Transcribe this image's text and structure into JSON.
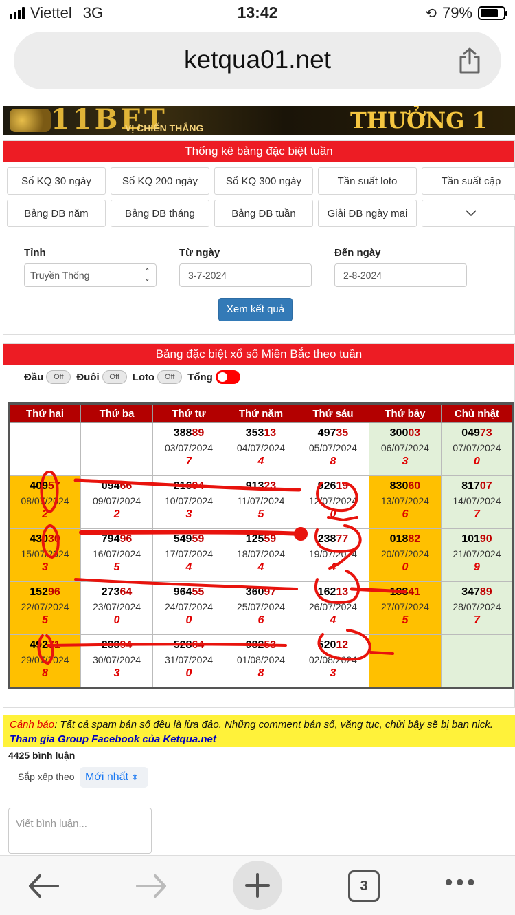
{
  "status": {
    "carrier": "Viettel",
    "network": "3G",
    "time": "13:42",
    "battery": "79%",
    "battery_level": 0.79
  },
  "browser": {
    "url": "ketqua01.net"
  },
  "banner": {
    "logo": "11BET",
    "tagline": "VỊ CHIẾN THẮNG",
    "promo": "THƯỞNG 1"
  },
  "panel1": {
    "title": "Thống kê bảng đặc biệt tuần",
    "buttons_row1": [
      "Sổ KQ 30 ngày",
      "Sổ KQ 200 ngày",
      "Sổ KQ 300 ngày",
      "Tần suất loto",
      "Tần suất cặp"
    ],
    "buttons_row2": [
      "Bảng ĐB năm",
      "Bảng ĐB tháng",
      "Bảng ĐB tuần",
      "Giải ĐB ngày mai"
    ],
    "province_label": "Tỉnh",
    "province_value": "Truyền Thống",
    "from_label": "Từ ngày",
    "from_value": "3-7-2024",
    "to_label": "Đến ngày",
    "to_value": "2-8-2024",
    "submit": "Xem kết quả"
  },
  "panel2": {
    "title": "Bảng đặc biệt xổ số Miền Bắc theo tuần",
    "toggles": [
      {
        "label": "Đầu",
        "state": "Off"
      },
      {
        "label": "Đuôi",
        "state": "Off"
      },
      {
        "label": "Loto",
        "state": "Off"
      },
      {
        "label": "Tổng",
        "state": "On"
      }
    ],
    "headers": [
      "Thứ hai",
      "Thứ ba",
      "Thứ tư",
      "Thứ năm",
      "Thứ sáu",
      "Thứ bảy",
      "Chủ nhật"
    ],
    "rows": [
      [
        {
          "a": "",
          "b": "",
          "date": "",
          "sum": ""
        },
        {
          "a": "",
          "b": "",
          "date": "",
          "sum": ""
        },
        {
          "a": "388",
          "b": "89",
          "date": "03/07/2024",
          "sum": "7"
        },
        {
          "a": "353",
          "b": "13",
          "date": "04/07/2024",
          "sum": "4"
        },
        {
          "a": "497",
          "b": "35",
          "date": "05/07/2024",
          "sum": "8"
        },
        {
          "a": "300",
          "b": "03",
          "date": "06/07/2024",
          "sum": "3"
        },
        {
          "a": "049",
          "b": "73",
          "date": "07/07/2024",
          "sum": "0"
        }
      ],
      [
        {
          "a": "409",
          "b": "57",
          "date": "08/07/2024",
          "sum": "2"
        },
        {
          "a": "094",
          "b": "66",
          "date": "09/07/2024",
          "sum": "2"
        },
        {
          "a": "216",
          "b": "94",
          "date": "10/07/2024",
          "sum": "3"
        },
        {
          "a": "913",
          "b": "23",
          "date": "11/07/2024",
          "sum": "5"
        },
        {
          "a": "926",
          "b": "19",
          "date": "12/07/2024",
          "sum": "0"
        },
        {
          "a": "830",
          "b": "60",
          "date": "13/07/2024",
          "sum": "6"
        },
        {
          "a": "817",
          "b": "07",
          "date": "14/07/2024",
          "sum": "7"
        }
      ],
      [
        {
          "a": "430",
          "b": "30",
          "date": "15/07/2024",
          "sum": "3"
        },
        {
          "a": "794",
          "b": "96",
          "date": "16/07/2024",
          "sum": "5"
        },
        {
          "a": "549",
          "b": "59",
          "date": "17/07/2024",
          "sum": "4"
        },
        {
          "a": "125",
          "b": "59",
          "date": "18/07/2024",
          "sum": "4"
        },
        {
          "a": "238",
          "b": "77",
          "date": "19/07/2024",
          "sum": "4"
        },
        {
          "a": "018",
          "b": "82",
          "date": "20/07/2024",
          "sum": "0"
        },
        {
          "a": "101",
          "b": "90",
          "date": "21/07/2024",
          "sum": "9"
        }
      ],
      [
        {
          "a": "152",
          "b": "96",
          "date": "22/07/2024",
          "sum": "5"
        },
        {
          "a": "273",
          "b": "64",
          "date": "23/07/2024",
          "sum": "0"
        },
        {
          "a": "964",
          "b": "55",
          "date": "24/07/2024",
          "sum": "0"
        },
        {
          "a": "360",
          "b": "97",
          "date": "25/07/2024",
          "sum": "6"
        },
        {
          "a": "162",
          "b": "13",
          "date": "26/07/2024",
          "sum": "4"
        },
        {
          "a": "133",
          "b": "41",
          "date": "27/07/2024",
          "sum": "5"
        },
        {
          "a": "347",
          "b": "89",
          "date": "28/07/2024",
          "sum": "7"
        }
      ],
      [
        {
          "a": "492",
          "b": "71",
          "date": "29/07/2024",
          "sum": "8"
        },
        {
          "a": "233",
          "b": "94",
          "date": "30/07/2024",
          "sum": "3"
        },
        {
          "a": "528",
          "b": "64",
          "date": "31/07/2024",
          "sum": "0"
        },
        {
          "a": "982",
          "b": "53",
          "date": "01/08/2024",
          "sum": "8"
        },
        {
          "a": "520",
          "b": "12",
          "date": "02/08/2024",
          "sum": "3"
        },
        {
          "a": "",
          "b": "",
          "date": "",
          "sum": ""
        },
        {
          "a": "",
          "b": "",
          "date": "",
          "sum": ""
        }
      ]
    ],
    "highlight_colors": {
      "yellow": "#ffc000",
      "green": "#e2f0d9",
      "header": "#b30000",
      "ink": "#e8130d"
    }
  },
  "warning": {
    "prefix": "Cảnh báo",
    "text": ": Tất cả spam bán số đều là lừa đảo. Những comment bán số, văng tục, chửi bậy sẽ bị ban nick.",
    "link": "Tham gia Group Facebook của Ketqua.net"
  },
  "comments": {
    "count": "4425 bình luận",
    "sort_label": "Sắp xếp theo",
    "sort_value": "Mới nhất",
    "placeholder": "Viết bình luận..."
  },
  "bottom_bar": {
    "tab_count": "3"
  }
}
